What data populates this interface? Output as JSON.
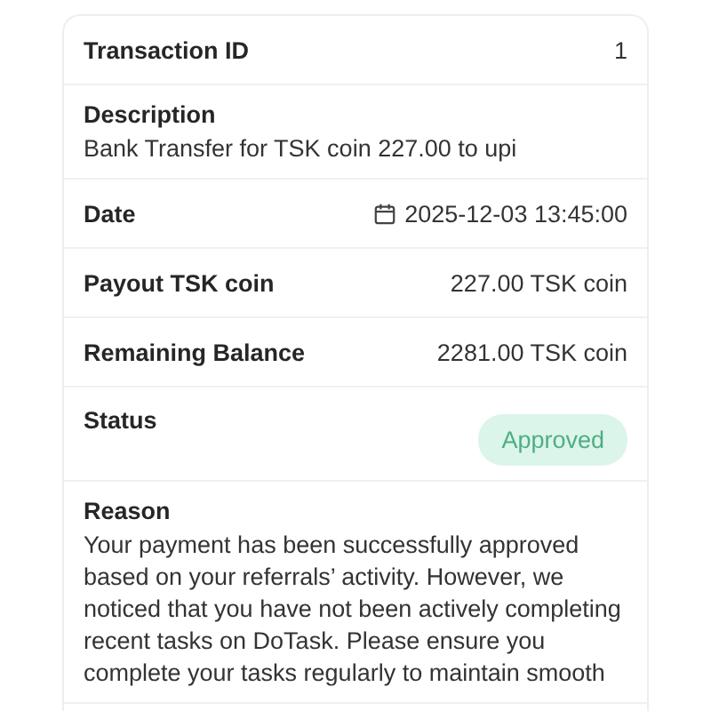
{
  "transaction": {
    "id": {
      "label": "Transaction ID",
      "value": "1"
    },
    "description": {
      "label": "Description",
      "value": "Bank Transfer for TSK coin 227.00 to upi"
    },
    "date": {
      "label": "Date",
      "value": "2025-12-03 13:45:00"
    },
    "payout": {
      "label": "Payout TSK coin",
      "value": "227.00 TSK coin"
    },
    "remaining_balance": {
      "label": "Remaining Balance",
      "value": "2281.00 TSK coin"
    },
    "status": {
      "label": "Status",
      "value": "Approved",
      "kind": "approved"
    },
    "reason": {
      "label": "Reason",
      "value": "Your payment has been successfully approved based on your referrals’ activity. However, we noticed that you have not been actively completing recent tasks on DoTask. Please ensure you complete your tasks regularly to maintain smooth"
    }
  }
}
